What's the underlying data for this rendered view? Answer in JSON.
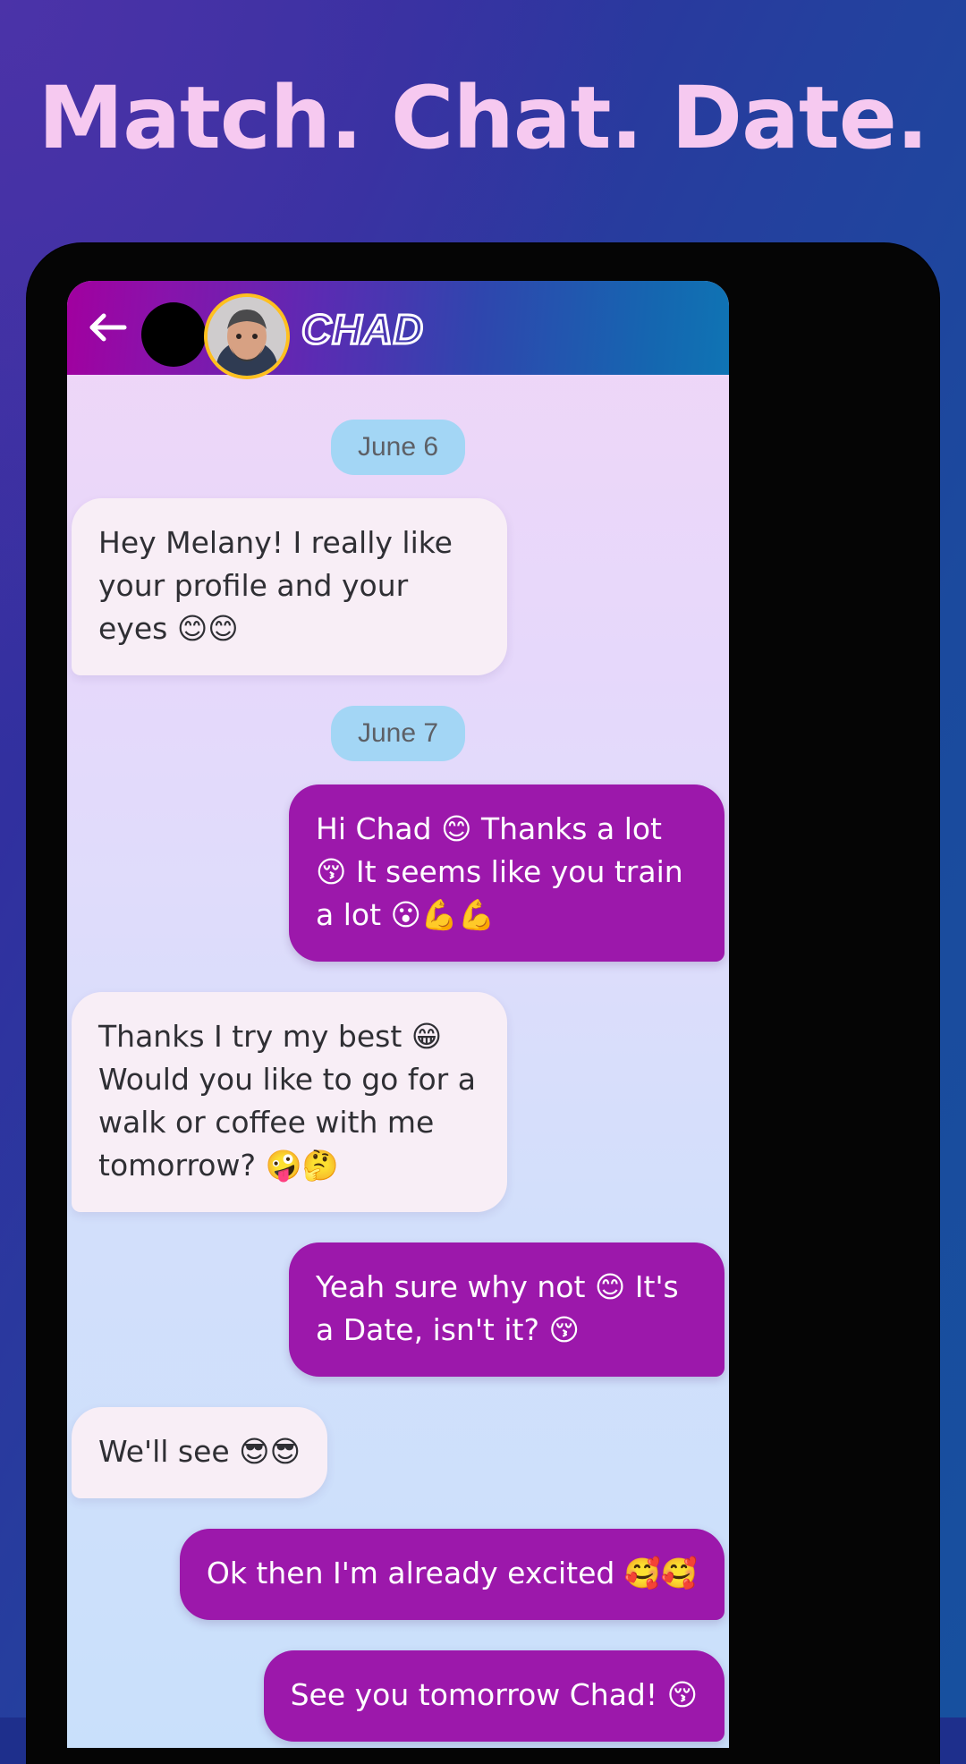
{
  "promo": {
    "headline": "Match. Chat. Date.",
    "headline_color": "#f6c9f0",
    "background_colors": [
      "#3b2fa0",
      "#1b4a9e"
    ]
  },
  "app": {
    "header": {
      "back_icon": "back-arrow-icon",
      "avatar_alt": "chad-avatar",
      "avatar_ring_color": "#ffc01f",
      "contact_name": "CHAD",
      "gradient_colors": [
        "#a1009f",
        "#0f74b4"
      ]
    },
    "theme": {
      "incoming_bubble_color": "#f8eef6",
      "outgoing_bubble_color": "#9c18ab",
      "date_pill_color": "#a3d6f5",
      "incoming_text_color": "#2f2f34",
      "outgoing_text_color": "#ffffff"
    },
    "conversation": [
      {
        "kind": "date",
        "label": "June 6"
      },
      {
        "kind": "message",
        "side": "in",
        "text": "Hey Melany! I really like your profile and your eyes 😊😊"
      },
      {
        "kind": "date",
        "label": "June 7"
      },
      {
        "kind": "message",
        "side": "out",
        "text": "Hi Chad 😊 Thanks a lot 😚 It seems like you train a lot 😮💪💪"
      },
      {
        "kind": "message",
        "side": "in",
        "text": "Thanks I try my best 😁 Would you like to go for a walk or coffee with me tomorrow? 🤪🤔"
      },
      {
        "kind": "message",
        "side": "out",
        "text": "Yeah sure why not 😊 It's a Date, isn't it? 😚"
      },
      {
        "kind": "message",
        "side": "in",
        "text": "We'll see 😎😎"
      },
      {
        "kind": "message",
        "side": "out",
        "text": "Ok then I'm already excited 🥰🥰"
      },
      {
        "kind": "message",
        "side": "out",
        "text": "See you tomorrow Chad! 😚"
      }
    ]
  }
}
